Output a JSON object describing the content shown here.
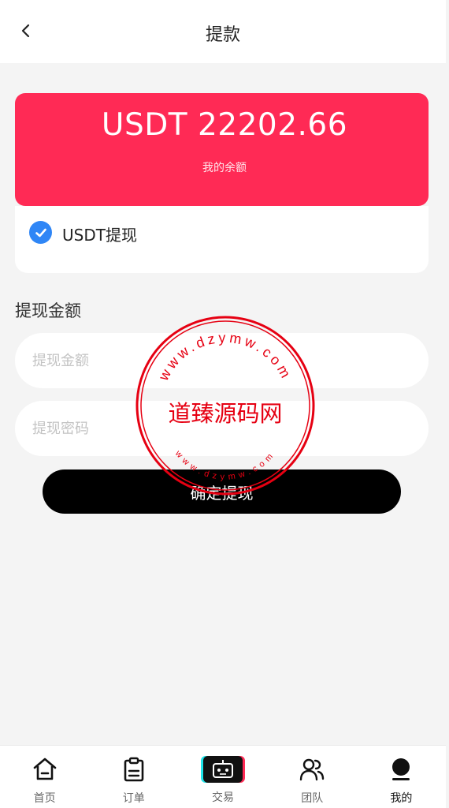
{
  "header": {
    "title": "提款"
  },
  "balance": {
    "amount": "USDT 22202.66",
    "label": "我的余额"
  },
  "withdraw_method": {
    "label": "USDT提现",
    "checked": true
  },
  "amount_section": {
    "label": "提现金额"
  },
  "inputs": {
    "amount_placeholder": "提现金额",
    "password_placeholder": "提现密码"
  },
  "submit": {
    "label": "确定提现"
  },
  "watermark": {
    "center_text": "道臻源码网",
    "ring_text": "www.dzymw.com",
    "color": "#e60012"
  },
  "tabbar": {
    "items": [
      {
        "label": "首页",
        "icon": "home-icon",
        "active": false
      },
      {
        "label": "订单",
        "icon": "clipboard-icon",
        "active": false
      },
      {
        "label": "交易",
        "icon": "robot-icon",
        "active": false
      },
      {
        "label": "团队",
        "icon": "team-icon",
        "active": false
      },
      {
        "label": "我的",
        "icon": "user-icon",
        "active": true
      }
    ]
  },
  "colors": {
    "accent": "#ff2a55",
    "check": "#2f86f6",
    "button": "#000000",
    "background": "#f4f4f4"
  }
}
